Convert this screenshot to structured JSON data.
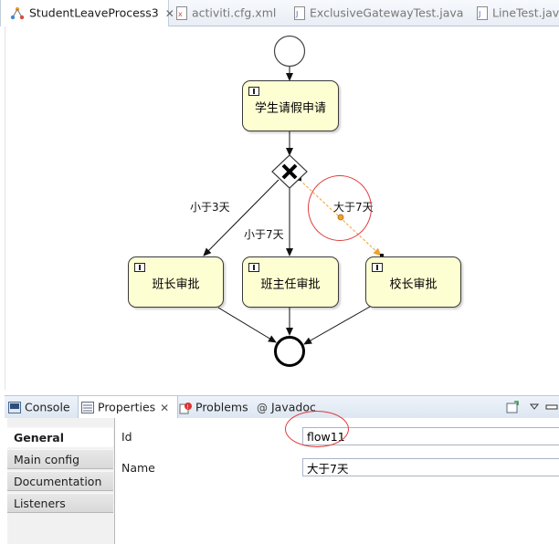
{
  "editor_tabs": [
    {
      "label": "StudentLeaveProcess3",
      "active": true,
      "icon": "process-diagram-icon",
      "closable": true
    },
    {
      "label": "activiti.cfg.xml",
      "active": false,
      "icon": "xml-file-icon"
    },
    {
      "label": "ExclusiveGatewayTest.java",
      "active": false,
      "icon": "java-file-icon"
    },
    {
      "label": "LineTest.java",
      "active": false,
      "icon": "java-file-icon"
    }
  ],
  "diagram": {
    "tasks": {
      "apply": "学生请假申请",
      "class_teacher": "班长审批",
      "head_teacher": "班主任审批",
      "principal": "校长审批"
    },
    "flows": {
      "lt3": "小于3天",
      "lt7": "小于7天",
      "gt7": "大于7天"
    },
    "selected_flow_color": "#f0a030",
    "highlight_color": "#e03a3a"
  },
  "view_tabs": [
    {
      "label": "Console",
      "icon": "console-icon",
      "active": false
    },
    {
      "label": "Properties",
      "icon": "properties-icon",
      "active": true,
      "closable": true
    },
    {
      "label": "Problems",
      "icon": "problems-icon",
      "active": false
    },
    {
      "label": "Javadoc",
      "icon": "at-icon",
      "active": false,
      "glyph": "@"
    }
  ],
  "properties": {
    "side_tabs": [
      "General",
      "Main config",
      "Documentation",
      "Listeners"
    ],
    "active_side_tab": "General",
    "fields": [
      {
        "label": "Id",
        "value": "flow11"
      },
      {
        "label": "Name",
        "value": "大于7天"
      }
    ]
  }
}
